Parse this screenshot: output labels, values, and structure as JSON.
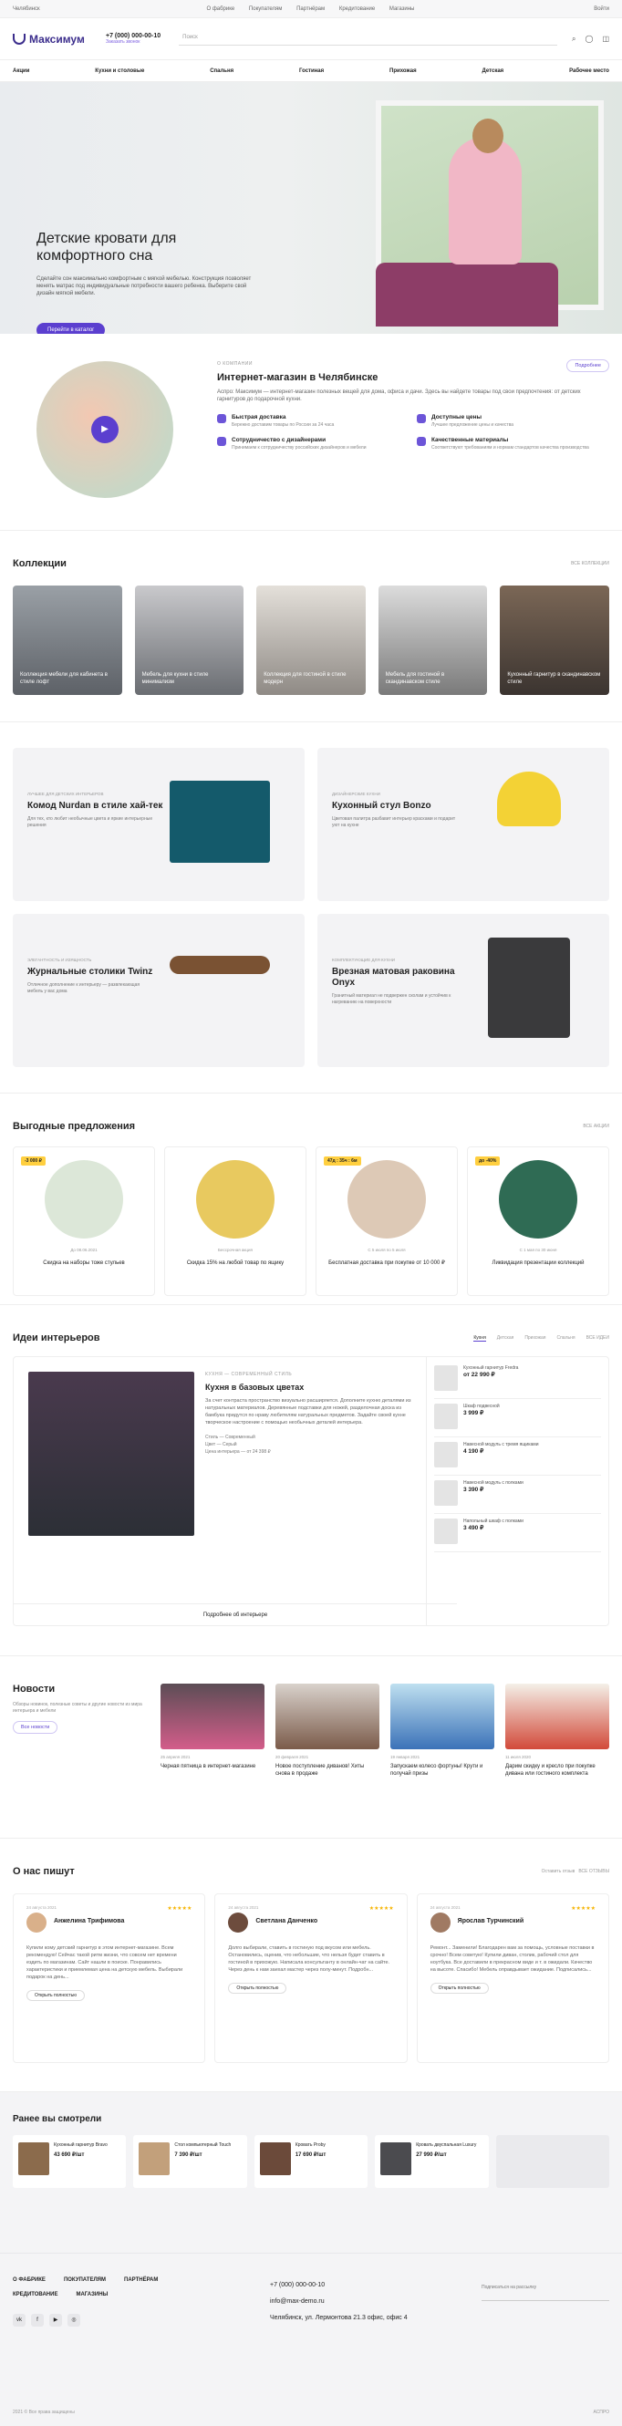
{
  "topbar": {
    "city": "Челябинск",
    "links": [
      "О фабрике",
      "Покупателям",
      "Партнёрам",
      "Кредитование",
      "Магазины"
    ],
    "login": "Войти"
  },
  "header": {
    "phone": "+7 (000) 000-00-10",
    "callback": "Заказать звонок",
    "search_placeholder": "Поиск"
  },
  "menu": [
    "Акции",
    "Кухни и столовые",
    "Спальня",
    "Гостиная",
    "Прихожая",
    "Детская",
    "Рабочее место"
  ],
  "hero": {
    "title": "Детские кровати для комфортного сна",
    "text": "Сделайте сон максимально комфортным с мягкой мебелью. Конструкция позволяет менять матрас под индивидуальные потребности вашего ребенка. Выберите свой дизайн мягкой мебели.",
    "button": "Перейти в каталог"
  },
  "about": {
    "tag": "О компании",
    "title": "Интернет-магазин в Челябинске",
    "text": "Аспро: Максимум — интернет-магазин полезных вещей для дома, офиса и дачи. Здесь вы найдете товары под свои предпочтения: от детских гарнитуров до подарочной кухни.",
    "more": "Подробнее",
    "features": [
      {
        "t": "Быстрая доставка",
        "s": "Бережно доставим товары по России за 24 часа"
      },
      {
        "t": "Доступные цены",
        "s": "Лучшее предложение цены и качества"
      },
      {
        "t": "Сотрудничество с дизайнерами",
        "s": "Принимаем к сотрудничеству российских дизайнеров и мебели"
      },
      {
        "t": "Качественные материалы",
        "s": "Соответствуют требованиям и нормам стандартов качества производства"
      }
    ]
  },
  "collections": {
    "title": "Коллекции",
    "all": "ВСЕ КОЛЛЕКЦИИ",
    "items": [
      "Коллекция мебели для кабинета в стиле лофт",
      "Мебель для кухни в стиле минимализм",
      "Коллекция для гостиной в стиле модерн",
      "Мебель для гостиной в скандинавском стиле",
      "Кухонный гарнитур в скандинавском стиле"
    ]
  },
  "products": [
    {
      "cap": "ЛУЧШЕЕ ДЛЯ ДЕТСКИХ ИНТЕРЬЕРОВ",
      "title": "Комод Nurdan в стиле хай-тек",
      "text": "Для тех, кто любит необычные цвета и яркие интерьерные решения"
    },
    {
      "cap": "ДИЗАЙНЕРСКИЕ КУХНИ",
      "title": "Кухонный стул Bonzo",
      "text": "Цветовая палитра разбавит интерьер красками и подарит уют на кухне"
    },
    {
      "cap": "ЭЛЕГАНТНОСТЬ И ИЗЯЩНОСТЬ",
      "title": "Журнальные столики Twinz",
      "text": "Отличное дополнение к интерьеру — развлекающая мебель у вас дома"
    },
    {
      "cap": "КОМПЛЕКТУЮЩИЕ ДЛЯ КУХНИ",
      "title": "Врезная матовая раковина Onyx",
      "text": "Гранитный материал не подвержен сколам и устойчив к нагреванию на поверхности"
    }
  ],
  "offers": {
    "title": "Выгодные предложения",
    "all": "ВСЕ АКЦИИ",
    "items": [
      {
        "badge": "-3 000 ₽",
        "meta": "До 08.06.2021",
        "title": "Скидка на наборы тоже стульев"
      },
      {
        "badge": "",
        "meta": "Бессрочная акция",
        "title": "Скидка 15% на любой товар по ящику"
      },
      {
        "badge": "47д : 35ч : 6м",
        "meta": "С 5 июля по 5 июля",
        "title": "Бесплатная доставка при покупке от 10 000 ₽"
      },
      {
        "badge": "до -40%",
        "meta": "С 1 мая по 30 июня",
        "title": "Ликвидация презентации коллекций"
      }
    ]
  },
  "ideas": {
    "title": "Идеи интерьеров",
    "tabs": [
      "Кухня",
      "Детская",
      "Прихожая",
      "Спальня"
    ],
    "all": "ВСЕ ИДЕИ",
    "item": {
      "tag": "КУХНЯ — СОВРЕМЕННЫЙ СТИЛЬ",
      "title": "Кухня в базовых цветах",
      "text": "За счет контраста пространство визуально расширяется. Дополните кухню деталями из натуральных материалов. Деревянные подставки для ножей, разделочная доска из бамбука придутся по нраву любителям натуральных предметов. Задайте своей кухне творческое настроение с помощью необычных деталей интерьера.",
      "spec": [
        "Стиль — Современный",
        "Цвет — Серый",
        "Цена интерьера — от 24 398 ₽"
      ],
      "more": "Подробнее об интерьере"
    },
    "list": [
      {
        "n": "Кухонный гарнитур Fredra",
        "p": "от 22 990 ₽"
      },
      {
        "n": "Шкаф подвесной",
        "p": "3 999 ₽"
      },
      {
        "n": "Навесной модуль с тремя ящиками",
        "p": "4 190 ₽"
      },
      {
        "n": "Навесной модуль с полками",
        "p": "3 390 ₽"
      },
      {
        "n": "Напольный шкаф с полками",
        "p": "3 490 ₽"
      }
    ]
  },
  "news": {
    "title": "Новости",
    "text": "Обзоры новинок, полезные советы и другие новости из мира интерьера и мебели",
    "all": "Все новости",
    "items": [
      {
        "d": "25 апреля 2021",
        "t": "Черная пятница в интернет-магазине"
      },
      {
        "d": "20 февраля 2021",
        "t": "Новое поступление диванов! Хиты снова в продаже"
      },
      {
        "d": "19 января 2021",
        "t": "Запускаем колесо фортуны! Крути и получай призы"
      },
      {
        "d": "11 июля 2020",
        "t": "Дарим скидку и кресло при покупке дивана или гостиного комплекта"
      }
    ]
  },
  "reviews": {
    "title": "О нас пишут",
    "add": "Оставить отзыв",
    "all": "ВСЕ ОТЗЫВЫ",
    "items": [
      {
        "d": "24 августа 2021",
        "n": "Анжелина Трифимова",
        "t": "Купили кому детский гарнитур в этом интернет-магазине. Всем рекомендую! Сейчас такой ритм жизни, что совсем нет времени ездить по магазинам. Сайт нашли в поиске. Понравились характеристики и приемлемая цена на детскую мебель. Выбирали подарок на день..."
      },
      {
        "d": "24 августа 2021",
        "n": "Светлана Данченко",
        "t": "Долго выбирали, ставить в гостиную под вкусом или мебель. Остановились, оценив, что небольшие, что нельзя будет ставить в гостиной в прихожую. Написала консультанту в онлайн-чат на сайте. Через день к нам заехал мастер через полу-минут. Подробн..."
      },
      {
        "d": "24 августа 2021",
        "n": "Ярослав Турчинский",
        "t": "Ремонт... Заменили! Благодарен вам за помощь, условные поставки в срочно! Всем советую! Купили диван, столик, рабочий стол для ноутбука. Все доставили в прекрасном виде и т. в ожидали. Качество на высоте. Спасибо! Мебель оправдывает ожидание. Подписались..."
      }
    ],
    "more": "Открыть полностью"
  },
  "viewed": {
    "title": "Ранее вы смотрели",
    "items": [
      {
        "n": "Кухонный гарнитур Bravo",
        "p": "43 690 ₽/шт"
      },
      {
        "n": "Стол компьютерный Touch",
        "p": "7 390 ₽/шт"
      },
      {
        "n": "Кровать Proby",
        "p": "17 690 ₽/шт"
      },
      {
        "n": "Кровать двуспальная Luxury",
        "p": "27 990 ₽/шт"
      }
    ]
  },
  "footer": {
    "cols": [
      "О ФАБРИКЕ",
      "ПОКУПАТЕЛЯМ",
      "ПАРТНЁРАМ",
      "КРЕДИТОВАНИЕ",
      "МАГАЗИНЫ"
    ],
    "phone": "+7 (000) 000-00-10",
    "email": "info@max-demo.ru",
    "address": "Челябинск, ул. Лермонтова 21.3 офис, офис 4",
    "subscribe": "Подписаться на рассылку",
    "copyright": "2021 © Все права защищены",
    "brand": "АСПРО"
  }
}
